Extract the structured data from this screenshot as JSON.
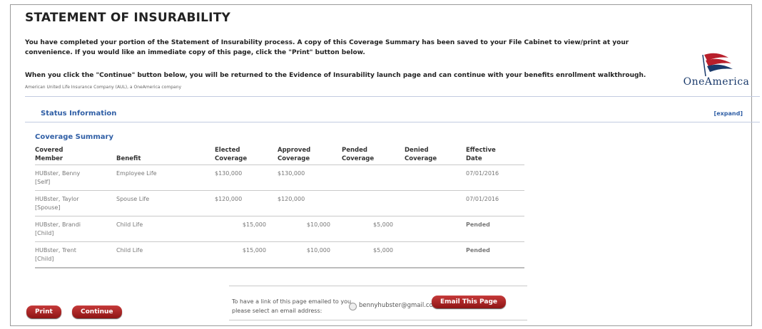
{
  "page": {
    "title": "STATEMENT OF INSURABILITY",
    "intro": "You have completed your portion of the Statement of Insurability process. A copy of this Coverage Summary has been saved to your File Cabinet to view/print at your convenience. If you would like an immediate copy of this page, click the \"Print\" button below.",
    "intro2": "When you click the \"Continue\" button below, you will be returned to the Evidence of Insurability launch page and can continue with your benefits enrollment walkthrough.",
    "company_note": "American United Life Insurance Company (AUL), a OneAmerica company",
    "logo_text": "OneAmerica"
  },
  "status": {
    "header": "Status Information",
    "expand": "[expand]"
  },
  "summary": {
    "title": "Coverage Summary",
    "headers": {
      "member": [
        "Covered",
        "Member"
      ],
      "benefit": "Benefit",
      "elected": [
        "Elected",
        "Coverage"
      ],
      "approved": [
        "Approved",
        "Coverage"
      ],
      "pended": [
        "Pended",
        "Coverage"
      ],
      "denied": [
        "Denied",
        "Coverage"
      ],
      "effective": [
        "Effective",
        "Date"
      ]
    },
    "rows": [
      {
        "name": "HUBster, Benny",
        "rel": "[Self]",
        "benefit": "Employee Life",
        "elected": "$130,000",
        "approved": "$130,000",
        "pended": "",
        "denied": "",
        "effective": "07/01/2016"
      },
      {
        "name": "HUBster, Taylor",
        "rel": "[Spouse]",
        "benefit": "Spouse Life",
        "elected": "$120,000",
        "approved": "$120,000",
        "pended": "",
        "denied": "",
        "effective": "07/01/2016"
      },
      {
        "name": "HUBster, Brandi",
        "rel": "[Child]",
        "benefit": "Child Life",
        "elected": "$15,000",
        "approved": "$10,000",
        "pended": "$5,000",
        "denied": "",
        "effective": "Pended"
      },
      {
        "name": "HUBster, Trent",
        "rel": "[Child]",
        "benefit": "Child Life",
        "elected": "$15,000",
        "approved": "$10,000",
        "pended": "$5,000",
        "denied": "",
        "effective": "Pended"
      }
    ]
  },
  "actions": {
    "print": "Print",
    "continue": "Continue",
    "email_label": "To have a link of this page emailed to you, please select an email address:",
    "email_address": "bennyhubster@gmail.com",
    "email_button": "Email This Page"
  },
  "colors": {
    "accent_blue": "#2f5ea5",
    "button_red": "#a82020",
    "pended_orange": "#e07a1f",
    "logo_navy": "#1a3a6b"
  }
}
